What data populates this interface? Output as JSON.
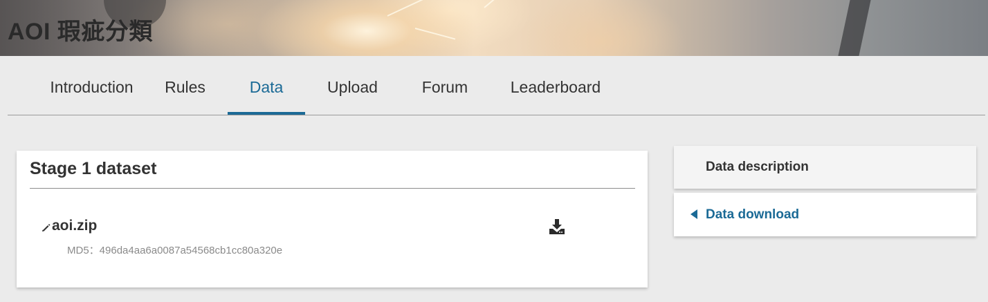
{
  "header": {
    "title": "AOI 瑕疵分類"
  },
  "tabs": [
    {
      "label": "Introduction",
      "active": false
    },
    {
      "label": "Rules",
      "active": false
    },
    {
      "label": "Data",
      "active": true
    },
    {
      "label": "Upload",
      "active": false
    },
    {
      "label": "Forum",
      "active": false
    },
    {
      "label": "Leaderboard",
      "active": false
    }
  ],
  "dataset": {
    "title": "Stage 1 dataset",
    "file": {
      "name": "aoi.zip",
      "md5": "MD5：496da4aa6a0087a54568cb1cc80a320e",
      "file_icon": "paperclip-icon",
      "download_icon": "download-icon"
    }
  },
  "side_nav": {
    "items": [
      {
        "label": "Data description",
        "active": false
      },
      {
        "label": "Data download",
        "active": true,
        "icon": "caret-left-icon"
      }
    ]
  },
  "colors": {
    "accent": "#1b6a96",
    "background": "#ebebeb",
    "text": "#333333",
    "muted": "#8a8a8a"
  }
}
